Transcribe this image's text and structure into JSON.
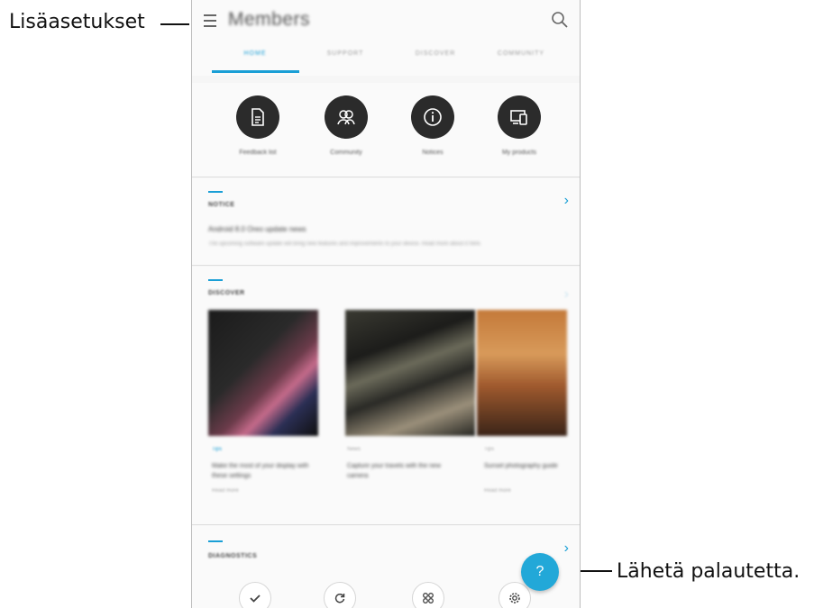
{
  "callouts": {
    "menu": "Lisäasetukset",
    "feedback": "Lähetä palautetta."
  },
  "appbar": {
    "title": "Members",
    "menu_icon": "hamburger-menu-icon",
    "search_icon": "search-icon"
  },
  "tabs": [
    {
      "label": "HOME",
      "active": true
    },
    {
      "label": "SUPPORT",
      "active": false
    },
    {
      "label": "DISCOVER",
      "active": false
    },
    {
      "label": "COMMUNITY",
      "active": false
    }
  ],
  "quick_actions": [
    {
      "label": "Feedback list",
      "icon": "document-icon"
    },
    {
      "label": "Community",
      "icon": "people-icon"
    },
    {
      "label": "Notices",
      "icon": "info-icon"
    },
    {
      "label": "My products",
      "icon": "devices-icon"
    }
  ],
  "notice": {
    "header": "NOTICE",
    "title": "Android 8.0 Oreo update news",
    "description": "The upcoming software update will bring new features and improvements to your device. Read more about it here."
  },
  "articles": {
    "header": "DISCOVER",
    "items": [
      {
        "meta": "Tips",
        "title": "Make the most of your display with these settings",
        "sub": "Read more"
      },
      {
        "meta": "News",
        "title": "Capture your travels with the new camera",
        "sub": ""
      },
      {
        "meta": "Tips",
        "title": "Sunset photography guide",
        "sub": "Read more"
      }
    ]
  },
  "bottom": {
    "header": "DIAGNOSTICS",
    "tools": [
      {
        "icon": "check-icon"
      },
      {
        "icon": "refresh-icon"
      },
      {
        "icon": "apps-grid-icon"
      },
      {
        "icon": "settings-icon"
      }
    ]
  },
  "fab": {
    "label": "?",
    "icon": "help-icon"
  },
  "colors": {
    "accent": "#1a9fd6",
    "fab": "#22a8d8",
    "dark_circle": "#2b2b2b"
  }
}
